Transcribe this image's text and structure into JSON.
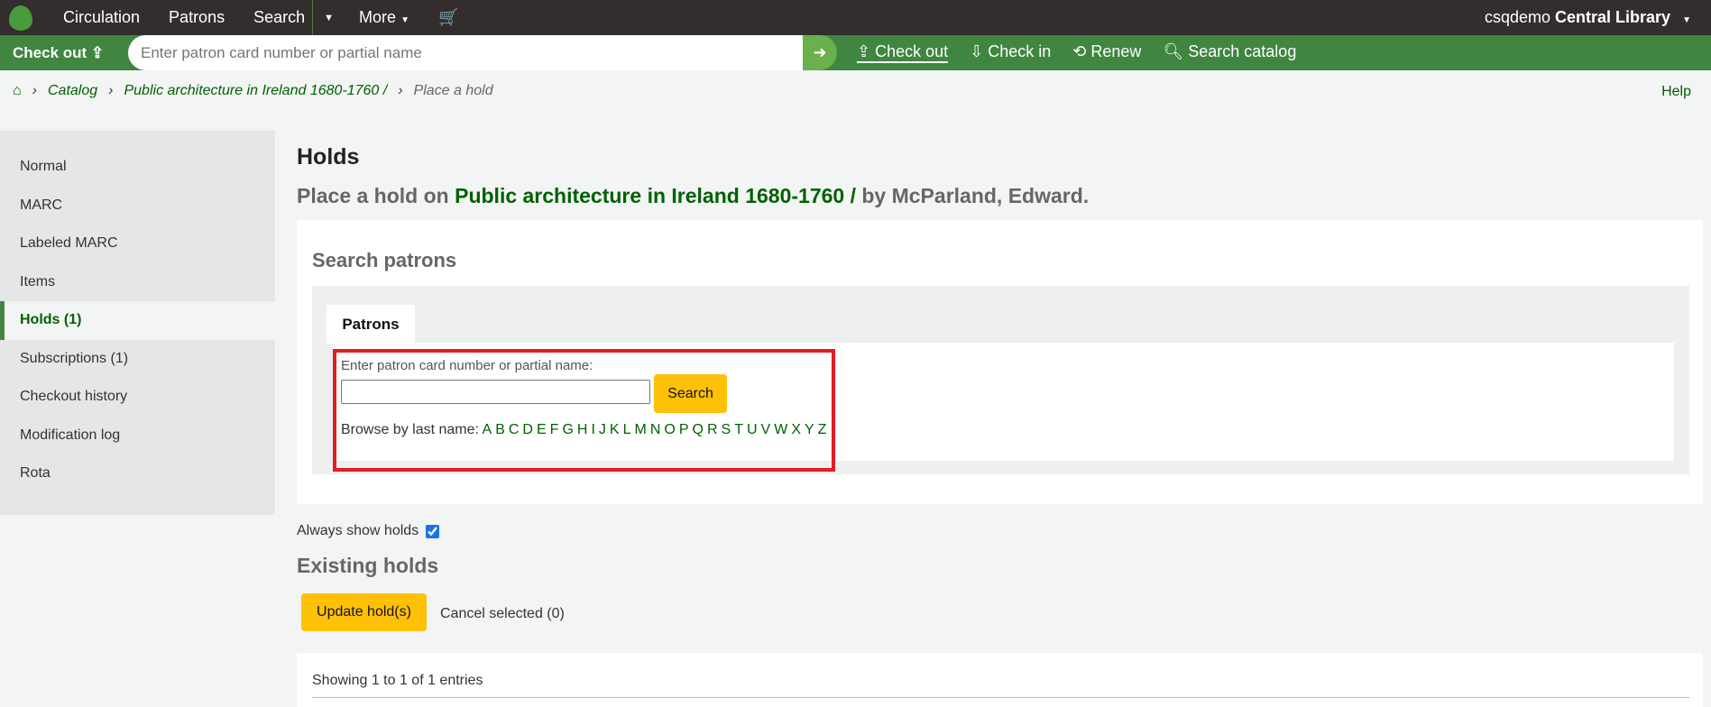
{
  "topnav": {
    "items": [
      "Circulation",
      "Patrons",
      "Search",
      "More"
    ],
    "user": "csqdemo",
    "library": "Central Library"
  },
  "quickbar": {
    "checkout_label": "Check out",
    "placeholder": "Enter patron card number or partial name",
    "actions": [
      "Check out",
      "Check in",
      "Renew",
      "Search catalog"
    ]
  },
  "breadcrumb": [
    "Catalog",
    "Public architecture in Ireland 1680-1760 /",
    "Place a hold"
  ],
  "help": "Help",
  "sidebar": {
    "items": [
      "Normal",
      "MARC",
      "Labeled MARC",
      "Items",
      "Holds (1)",
      "Subscriptions (1)",
      "Checkout history",
      "Modification log",
      "Rota"
    ],
    "active": "Holds (1)"
  },
  "page": {
    "title": "Holds",
    "subtitle_prefix": "Place a hold on",
    "book_title": "Public architecture in Ireland 1680-1760 /",
    "author": "by McParland, Edward."
  },
  "search": {
    "heading": "Search patrons",
    "tab": "Patrons",
    "label": "Enter patron card number or partial name:",
    "button": "Search",
    "browse_label": "Browse by last name:",
    "letters": [
      "A",
      "B",
      "C",
      "D",
      "E",
      "F",
      "G",
      "H",
      "I",
      "J",
      "K",
      "L",
      "M",
      "N",
      "O",
      "P",
      "Q",
      "R",
      "S",
      "T",
      "U",
      "V",
      "W",
      "X",
      "Y",
      "Z"
    ]
  },
  "holds": {
    "always_show": "Always show holds",
    "always_checked": true,
    "heading": "Existing holds",
    "update": "Update hold(s)",
    "cancel": "Cancel selected (0)",
    "showing": "Showing 1 to 1 of 1 entries"
  }
}
